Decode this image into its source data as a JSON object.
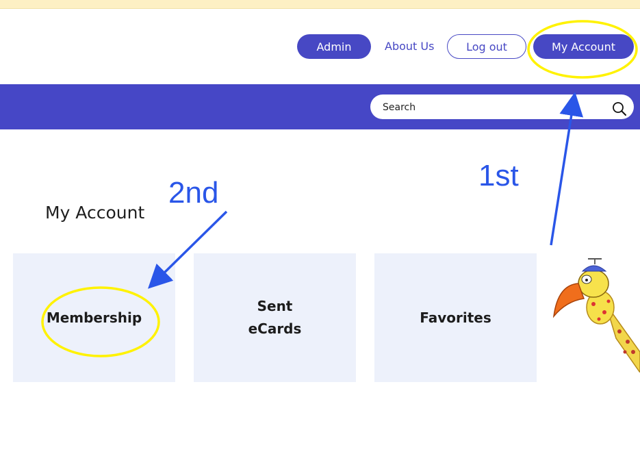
{
  "nav": {
    "admin": "Admin",
    "about": "About Us",
    "logout": "Log out",
    "my_account": "My Account"
  },
  "search": {
    "placeholder": "Search"
  },
  "page": {
    "title": "My Account"
  },
  "cards": [
    {
      "label": "Membership"
    },
    {
      "label": "Sent\neCards"
    },
    {
      "label": "Favorites"
    }
  ],
  "annotations": {
    "first": "1st",
    "second": "2nd"
  },
  "colors": {
    "brand": "#4748c4",
    "card_bg": "#edf1fb",
    "highlight": "#fff200",
    "annotation": "#2a56e8"
  },
  "icons": [
    "search-icon",
    "mascot-bird-icon"
  ]
}
